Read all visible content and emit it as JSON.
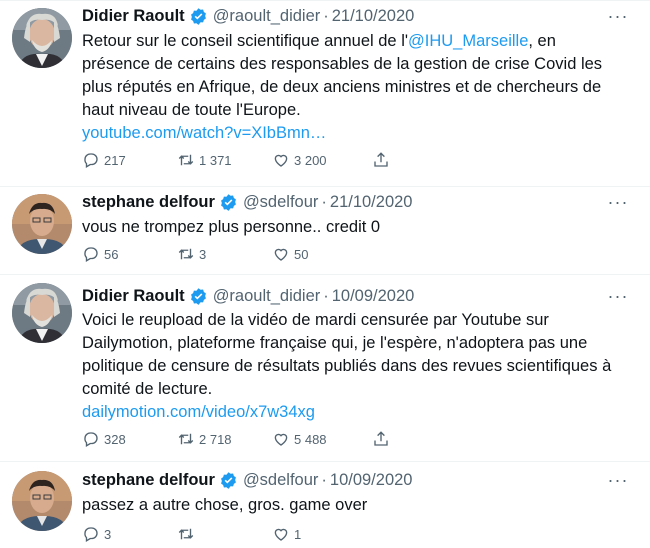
{
  "tweets": [
    {
      "name": "Didier Raoult",
      "handle": "@raoult_didier",
      "separator": "·",
      "date": "21/10/2020",
      "more_label": "···",
      "text_before": "Retour sur le conseil scientifique annuel de l'",
      "mention": "@IHU_Marseille",
      "text_after": ", en présence de certains des responsables de la gestion de crise Covid les plus réputés en Afrique, de deux anciens ministres et de chercheurs de haut niveau de toute l'Europe.",
      "link": "youtube.com/watch?v=XIbBmn…",
      "replies": "217",
      "retweets": "1 371",
      "likes": "3 200",
      "avatar": "raoult"
    },
    {
      "name": "stephane delfour",
      "handle": "@sdelfour",
      "separator": "·",
      "date": "21/10/2020",
      "more_label": "···",
      "text": "vous ne trompez plus personne.. credit 0",
      "replies": "56",
      "retweets": "3",
      "likes": "50",
      "avatar": "delfour"
    },
    {
      "name": "Didier Raoult",
      "handle": "@raoult_didier",
      "separator": "·",
      "date": "10/09/2020",
      "more_label": "···",
      "text": "Voici le reupload de la vidéo de mardi censurée par Youtube sur Dailymotion, plateforme française qui, je l'espère, n'adoptera pas une politique de censure de résultats publiés dans des revues scientifiques à comité de lecture.",
      "link": "dailymotion.com/video/x7w34xg",
      "replies": "328",
      "retweets": "2 718",
      "likes": "5 488",
      "avatar": "raoult"
    },
    {
      "name": "stephane delfour",
      "handle": "@sdelfour",
      "separator": "·",
      "date": "10/09/2020",
      "more_label": "···",
      "text": "passez a autre chose, gros. game over",
      "replies": "3",
      "retweets": "",
      "likes": "1",
      "avatar": "delfour"
    }
  ],
  "colors": {
    "link": "#1d9bf0",
    "verified": "#1d9bf0",
    "secondary_text": "#536471",
    "divider": "#eff3f4"
  },
  "icons": {
    "reply": "reply-icon",
    "retweet": "retweet-icon",
    "like": "like-icon",
    "share": "share-icon",
    "verified": "verified-badge-icon",
    "more": "more-options-icon"
  }
}
